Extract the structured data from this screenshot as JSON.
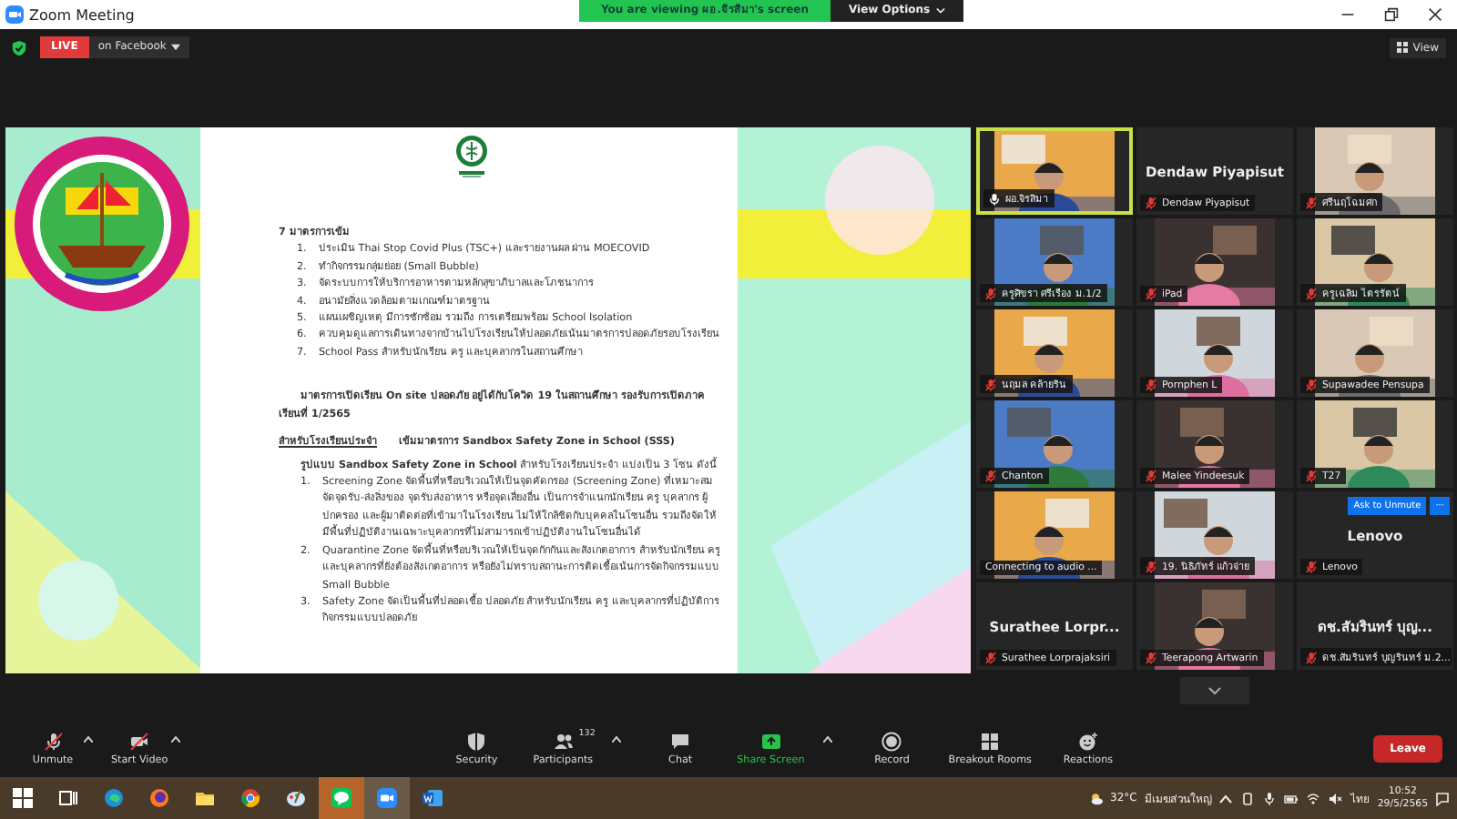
{
  "window": {
    "title": "Zoom Meeting",
    "controls": [
      {
        "kind": "minimize"
      },
      {
        "kind": "restore"
      },
      {
        "kind": "close"
      }
    ]
  },
  "banner": {
    "text": "You are viewing ผอ.จิรสิมา's screen",
    "options": "View Options"
  },
  "live": {
    "badge": "LIVE",
    "target": "on Facebook",
    "view": "View"
  },
  "document": {
    "heading": "7 มาตรการเข้ม",
    "measures": [
      {
        "num": "1.",
        "text": "ประเมิน Thai Stop Covid Plus (TSC+) และรายงานผล ผ่าน MOECOVID"
      },
      {
        "num": "2.",
        "text": "ทำกิจกรรมกลุ่มย่อย (Small Bubble)"
      },
      {
        "num": "3.",
        "text": "จัดระบบการให้บริการอาหารตามหลักสุขาภิบาลและโภชนาการ"
      },
      {
        "num": "4.",
        "text": "อนามัยสิ่งแวดล้อมตามเกณฑ์มาตรฐาน"
      },
      {
        "num": "5.",
        "text": "แผนเผชิญเหตุ มีการซักซ้อม รวมถึง การเตรียมพร้อม School Isolation"
      },
      {
        "num": "6.",
        "text": "ควบคุมดูแลการเดินทางจากบ้านไปโรงเรียนให้ปลอดภัยเน้นมาตรการปลอดภัยรอบโรงเรียน"
      },
      {
        "num": "7.",
        "text": "School Pass สำหรับนักเรียน ครู และบุคลากรในสถานศึกษา"
      }
    ],
    "intro": "มาตรการเปิดเรียน On site ปลอดภัย อยู่ได้กับโควิด 19 ในสถานศึกษา รองรับการเปิดภาคเรียนที่ 1/2565",
    "section_label": "สำหรับโรงเรียนประจำ",
    "section_title": "เข้มมาตรการ Sandbox Safety Zone in School (SSS)",
    "zones_intro": "**รูปแบบ Sandbox Safety Zone in School** สำหรับโรงเรียนประจำ แบ่งเป็น 3 โซน ดังนี้",
    "zones": [
      {
        "num": "1.",
        "text": "Screening Zone จัดพื้นที่หรือบริเวณให้เป็นจุดคัดกรอง (Screening Zone) ที่เหมาะสม จัดจุดรับ-ส่งสิ่งของ จุดรับส่งอาหาร หรือจุดเสี่ยงอื่น เป็นการจำแนกนักเรียน ครู บุคลากร ผู้ปกครอง และผู้มาติดต่อที่เข้ามาในโรงเรียน ไม่ให้ใกล้ชิดกับบุคคลในโซนอื่น รวมถึงจัดให้มีพื้นที่ปฏิบัติงานเฉพาะบุคลากรที่ไม่สามารถเข้าปฏิบัติงานในโซนอื่นได้"
      },
      {
        "num": "2.",
        "text": "Quarantine Zone จัดพื้นที่หรือบริเวณให้เป็นจุดกักกันและสังเกตอาการ สำหรับนักเรียน ครู และบุคลากรที่ยังต้องสังเกตอาการ หรือยังไม่ทราบสถานะการติดเชื้อเน้นการจัดกิจกรรมแบบ Small Bubble"
      },
      {
        "num": "3.",
        "text": "Safety Zone จัดเป็นพื้นที่ปลอดเชื้อ ปลอดภัย สำหรับนักเรียน ครู และบุคลากรที่ปฏิบัติการกิจกรรมแบบปลอดภัย"
      }
    ]
  },
  "participants": [
    {
      "kind": "video",
      "name": "ผอ.จิรสิมา",
      "muted": false,
      "speaking": true
    },
    {
      "kind": "name",
      "display": "Dendaw Piyapisut",
      "name": "Dendaw Piyapisut",
      "muted": true,
      "speaking": false
    },
    {
      "kind": "video",
      "name": "ศรีนฤโฉมศก",
      "muted": true,
      "speaking": false
    },
    {
      "kind": "video",
      "name": "ครูศิขรา ศรีเรือง ม.1/2",
      "muted": true,
      "speaking": false
    },
    {
      "kind": "video",
      "name": "iPad",
      "muted": true,
      "speaking": false
    },
    {
      "kind": "video",
      "name": "ครูเฉลิม  ไตรรัตน์",
      "muted": true,
      "speaking": false
    },
    {
      "kind": "video",
      "name": "นฤมล คล้ายริน",
      "muted": true,
      "speaking": false
    },
    {
      "kind": "video",
      "name": "Pornphen L",
      "muted": true,
      "speaking": false
    },
    {
      "kind": "video",
      "name": "Supawadee Pensupa",
      "muted": true,
      "speaking": false
    },
    {
      "kind": "video",
      "name": "Chanton",
      "muted": true,
      "speaking": false
    },
    {
      "kind": "video",
      "name": "Malee Yindeesuk",
      "muted": true,
      "speaking": false
    },
    {
      "kind": "video",
      "name": "T27",
      "muted": true,
      "speaking": false
    },
    {
      "kind": "video",
      "name": "Connecting to audio ...",
      "speaking": false
    },
    {
      "kind": "video",
      "name": "19. นิธิภัทร์  แก้วจ่าย",
      "muted": true,
      "speaking": false
    },
    {
      "kind": "name",
      "display": "Lenovo",
      "name": "Lenovo",
      "muted": true,
      "speaking": false,
      "actions": {
        "ask": "Ask to Unmute",
        "more": "···"
      }
    },
    {
      "kind": "name",
      "display": "Surathee  Lorpr...",
      "name": "Surathee  Lorprajaksiri",
      "muted": true,
      "speaking": false
    },
    {
      "kind": "video",
      "name": "Teerapong Artwarin",
      "muted": true,
      "speaking": false
    },
    {
      "kind": "name",
      "display": "ดช.สัมรินทร์ บุญ...",
      "name": "ดช.สัมรินทร์ บุญรินทร์ ม.2...",
      "muted": true,
      "speaking": false
    }
  ],
  "toolbar": {
    "left": [
      {
        "kind": "mic",
        "label": "Unmute"
      },
      {
        "kind": "camera",
        "label": "Start Video"
      }
    ],
    "center": [
      {
        "kind": "security",
        "label": "Security"
      },
      {
        "kind": "participants",
        "label": "Participants",
        "count": "132"
      },
      {
        "kind": "chat",
        "label": "Chat"
      },
      {
        "kind": "share",
        "label": "Share Screen"
      },
      {
        "kind": "record",
        "label": "Record"
      },
      {
        "kind": "rooms",
        "label": "Breakout Rooms"
      },
      {
        "kind": "reactions",
        "label": "Reactions"
      }
    ],
    "leave": "Leave"
  },
  "taskbar": {
    "apps": [
      {
        "kind": "start",
        "active": false
      },
      {
        "kind": "taskview",
        "active": false
      },
      {
        "kind": "edge",
        "active": false
      },
      {
        "kind": "firefox",
        "active": false
      },
      {
        "kind": "folder",
        "active": false
      },
      {
        "kind": "chrome",
        "active": false
      },
      {
        "kind": "paint",
        "active": false
      },
      {
        "kind": "line",
        "active": true
      },
      {
        "kind": "zoom",
        "active": true
      },
      {
        "kind": "word",
        "active": false
      }
    ],
    "temperature": "32°C",
    "weather": "มีเมฆส่วนใหญ่",
    "language": "ไทย",
    "time": "10:52",
    "date": "29/5/2565"
  }
}
